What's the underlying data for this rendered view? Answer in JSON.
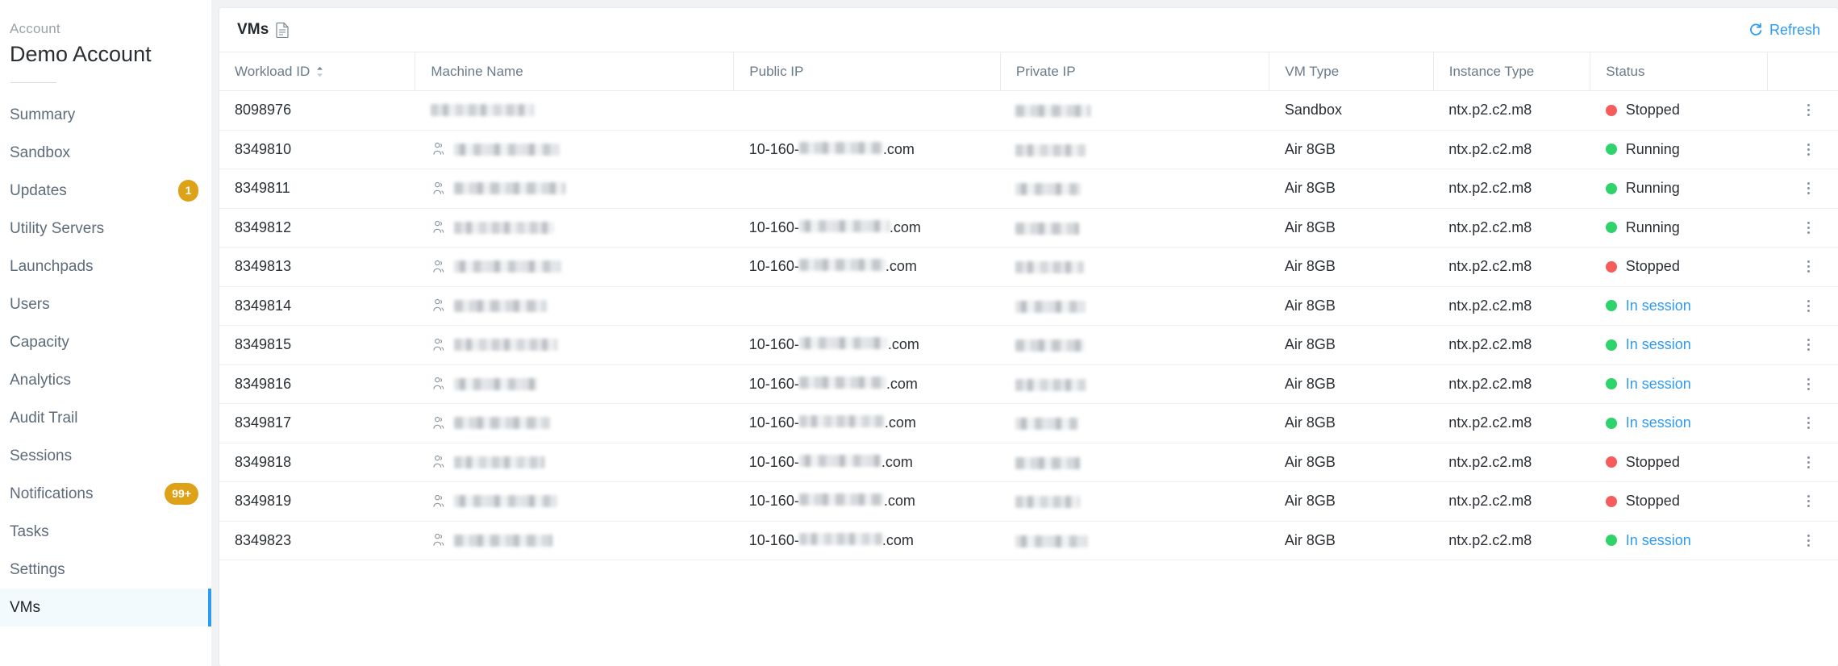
{
  "sidebar": {
    "account_label": "Account",
    "account_name": "Demo Account",
    "items": [
      {
        "label": "Summary",
        "badge": ""
      },
      {
        "label": "Sandbox",
        "badge": ""
      },
      {
        "label": "Updates",
        "badge": "1"
      },
      {
        "label": "Utility Servers",
        "badge": ""
      },
      {
        "label": "Launchpads",
        "badge": ""
      },
      {
        "label": "Users",
        "badge": ""
      },
      {
        "label": "Capacity",
        "badge": ""
      },
      {
        "label": "Analytics",
        "badge": ""
      },
      {
        "label": "Audit Trail",
        "badge": ""
      },
      {
        "label": "Sessions",
        "badge": ""
      },
      {
        "label": "Notifications",
        "badge": "99+"
      },
      {
        "label": "Tasks",
        "badge": ""
      },
      {
        "label": "Settings",
        "badge": ""
      },
      {
        "label": "VMs",
        "badge": ""
      }
    ],
    "active_item": "VMs",
    "badge_color": "#dda217",
    "active_accent": "#2f9bf0"
  },
  "card": {
    "title": "VMs",
    "title_icon": "document-icon",
    "refresh_label": "Refresh",
    "refresh_icon": "refresh-icon",
    "refresh_color": "#2f9bf0"
  },
  "table": {
    "columns": [
      {
        "key": "workload_id",
        "label": "Workload ID",
        "sortable": true
      },
      {
        "key": "machine_name",
        "label": "Machine Name",
        "sortable": false
      },
      {
        "key": "public_ip",
        "label": "Public IP",
        "sortable": false
      },
      {
        "key": "private_ip",
        "label": "Private IP",
        "sortable": false
      },
      {
        "key": "vm_type",
        "label": "VM Type",
        "sortable": false
      },
      {
        "key": "instance_type",
        "label": "Instance Type",
        "sortable": false
      },
      {
        "key": "status",
        "label": "Status",
        "sortable": false
      }
    ],
    "public_ip_prefix": "10-160-",
    "public_ip_suffix": ".com",
    "status_colors": {
      "Running": "#2fd36b",
      "Stopped": "#f75c5c",
      "In session": "#2fd36b"
    },
    "rows": [
      {
        "workload_id": "8098976",
        "machine_name": "",
        "has_user_icon": false,
        "machine_name_redacted": true,
        "name_width": 128,
        "public_ip": "",
        "public_ip_redacted": false,
        "private_ip": "",
        "private_ip_redacted": true,
        "priv_width": 93,
        "vm_type": "Sandbox",
        "instance_type": "ntx.p2.c2.m8",
        "status": "Stopped",
        "status_link": false
      },
      {
        "workload_id": "8349810",
        "machine_name": "",
        "has_user_icon": true,
        "machine_name_redacted": true,
        "name_width": 131,
        "public_ip": "",
        "public_ip_redacted": true,
        "pub_width": 104,
        "private_ip": "",
        "private_ip_redacted": true,
        "priv_width": 87,
        "vm_type": "Air 8GB",
        "instance_type": "ntx.p2.c2.m8",
        "status": "Running",
        "status_link": false
      },
      {
        "workload_id": "8349811",
        "machine_name": "",
        "has_user_icon": true,
        "machine_name_redacted": true,
        "name_width": 138,
        "public_ip": "",
        "public_ip_redacted": false,
        "private_ip": "",
        "private_ip_redacted": true,
        "priv_width": 81,
        "vm_type": "Air 8GB",
        "instance_type": "ntx.p2.c2.m8",
        "status": "Running",
        "status_link": false
      },
      {
        "workload_id": "8349812",
        "machine_name": "",
        "has_user_icon": true,
        "machine_name_redacted": true,
        "name_width": 124,
        "public_ip": "",
        "public_ip_redacted": true,
        "pub_width": 112,
        "private_ip": "",
        "private_ip_redacted": true,
        "priv_width": 79,
        "vm_type": "Air 8GB",
        "instance_type": "ntx.p2.c2.m8",
        "status": "Running",
        "status_link": false
      },
      {
        "workload_id": "8349813",
        "machine_name": "",
        "has_user_icon": true,
        "machine_name_redacted": true,
        "name_width": 133,
        "public_ip": "",
        "public_ip_redacted": true,
        "pub_width": 107,
        "private_ip": "",
        "private_ip_redacted": true,
        "priv_width": 85,
        "vm_type": "Air 8GB",
        "instance_type": "ntx.p2.c2.m8",
        "status": "Stopped",
        "status_link": false
      },
      {
        "workload_id": "8349814",
        "machine_name": "",
        "has_user_icon": true,
        "machine_name_redacted": true,
        "name_width": 115,
        "public_ip": "",
        "public_ip_redacted": false,
        "private_ip": "",
        "private_ip_redacted": true,
        "priv_width": 87,
        "vm_type": "Air 8GB",
        "instance_type": "ntx.p2.c2.m8",
        "status": "In session",
        "status_link": true
      },
      {
        "workload_id": "8349815",
        "machine_name": "",
        "has_user_icon": true,
        "machine_name_redacted": true,
        "name_width": 128,
        "public_ip": "",
        "public_ip_redacted": true,
        "pub_width": 110,
        "private_ip": "",
        "private_ip_redacted": true,
        "priv_width": 86,
        "vm_type": "Air 8GB",
        "instance_type": "ntx.p2.c2.m8",
        "status": "In session",
        "status_link": true
      },
      {
        "workload_id": "8349816",
        "machine_name": "",
        "has_user_icon": true,
        "machine_name_redacted": true,
        "name_width": 104,
        "public_ip": "",
        "public_ip_redacted": true,
        "pub_width": 108,
        "private_ip": "",
        "private_ip_redacted": true,
        "priv_width": 88,
        "vm_type": "Air 8GB",
        "instance_type": "ntx.p2.c2.m8",
        "status": "In session",
        "status_link": true
      },
      {
        "workload_id": "8349817",
        "machine_name": "",
        "has_user_icon": true,
        "machine_name_redacted": true,
        "name_width": 119,
        "public_ip": "",
        "public_ip_redacted": true,
        "pub_width": 106,
        "private_ip": "",
        "private_ip_redacted": true,
        "priv_width": 78,
        "vm_type": "Air 8GB",
        "instance_type": "ntx.p2.c2.m8",
        "status": "In session",
        "status_link": true
      },
      {
        "workload_id": "8349818",
        "machine_name": "",
        "has_user_icon": true,
        "machine_name_redacted": true,
        "name_width": 112,
        "public_ip": "",
        "public_ip_redacted": true,
        "pub_width": 102,
        "private_ip": "",
        "private_ip_redacted": true,
        "priv_width": 80,
        "vm_type": "Air 8GB",
        "instance_type": "ntx.p2.c2.m8",
        "status": "Stopped",
        "status_link": false
      },
      {
        "workload_id": "8349819",
        "machine_name": "",
        "has_user_icon": true,
        "machine_name_redacted": true,
        "name_width": 128,
        "public_ip": "",
        "public_ip_redacted": true,
        "pub_width": 105,
        "private_ip": "",
        "private_ip_redacted": true,
        "priv_width": 80,
        "vm_type": "Air 8GB",
        "instance_type": "ntx.p2.c2.m8",
        "status": "Stopped",
        "status_link": false
      },
      {
        "workload_id": "8349823",
        "machine_name": "",
        "has_user_icon": true,
        "machine_name_redacted": true,
        "name_width": 122,
        "public_ip": "",
        "public_ip_redacted": true,
        "pub_width": 103,
        "private_ip": "",
        "private_ip_redacted": true,
        "priv_width": 90,
        "vm_type": "Air 8GB",
        "instance_type": "ntx.p2.c2.m8",
        "status": "In session",
        "status_link": true
      }
    ],
    "row_menu_icon": "kebab-menu-icon"
  }
}
